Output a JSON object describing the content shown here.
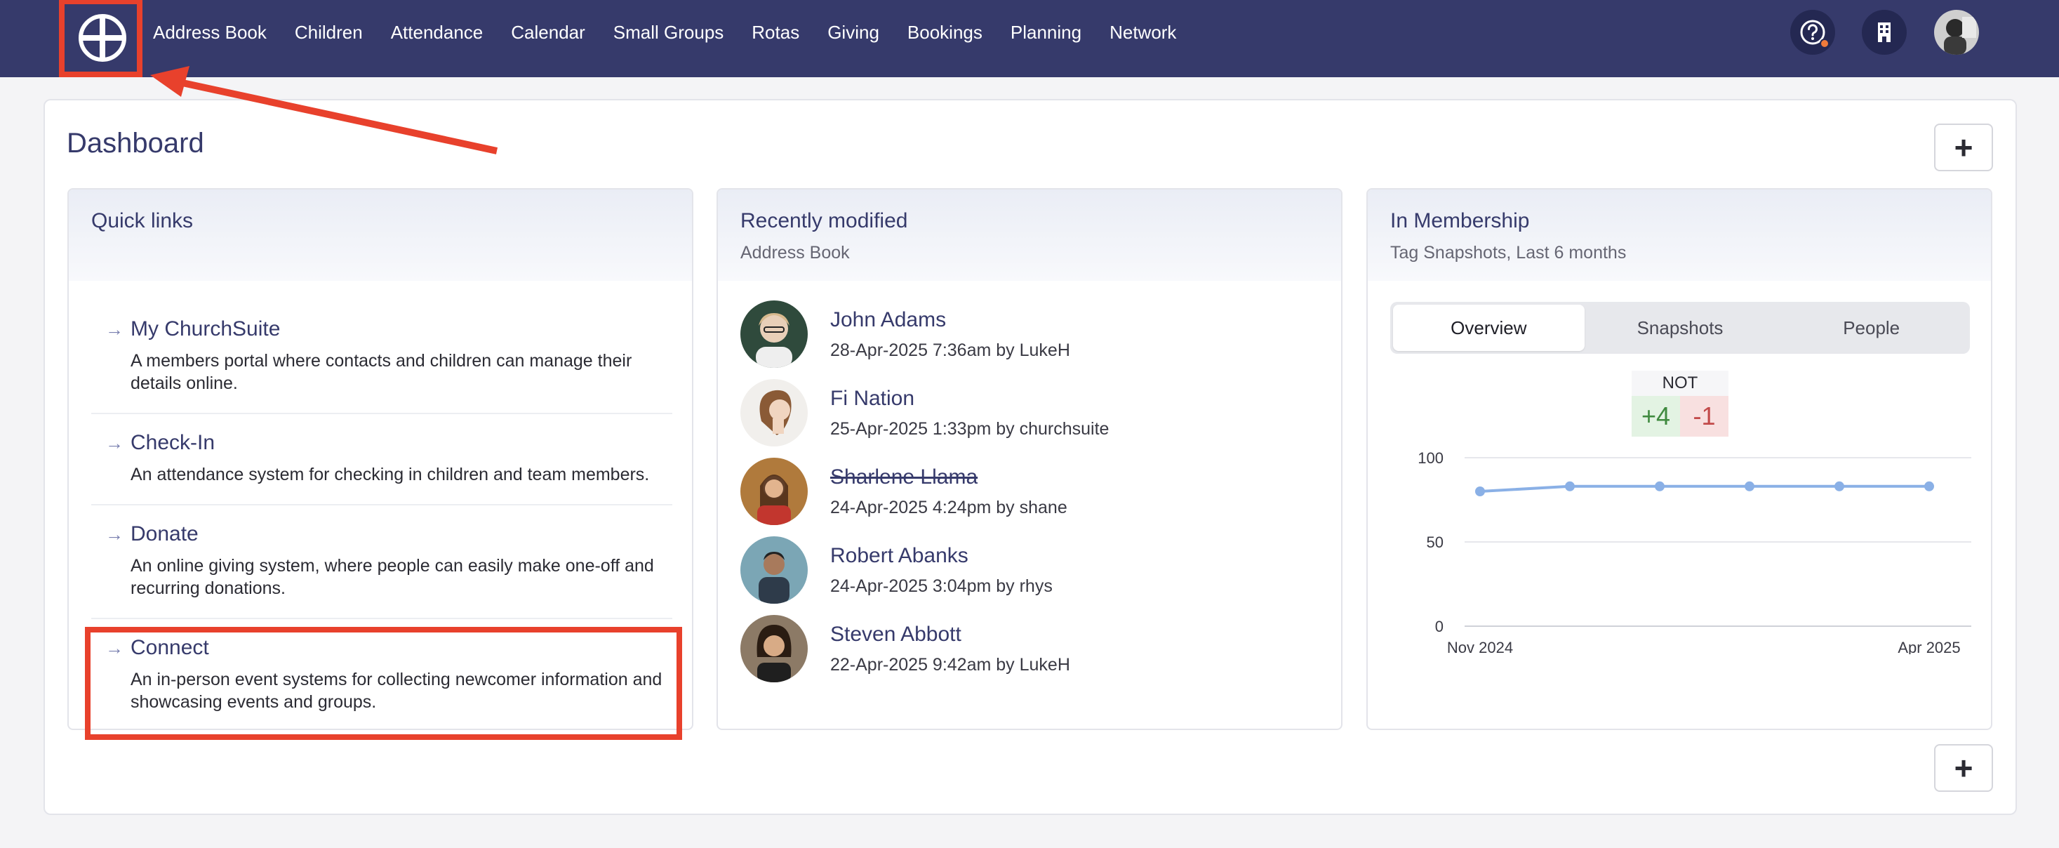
{
  "nav": {
    "links": [
      "Address Book",
      "Children",
      "Attendance",
      "Calendar",
      "Small Groups",
      "Rotas",
      "Giving",
      "Bookings",
      "Planning",
      "Network"
    ]
  },
  "page": {
    "title": "Dashboard"
  },
  "quick_links": {
    "title": "Quick links",
    "items": [
      {
        "title": "My ChurchSuite",
        "desc": "A members portal where contacts and children can manage their details online."
      },
      {
        "title": "Check-In",
        "desc": "An attendance system for checking in children and team members."
      },
      {
        "title": "Donate",
        "desc": "An online giving system, where people can easily make one-off and recurring donations."
      },
      {
        "title": "Connect",
        "desc": "An in-person event systems for collecting newcomer information and showcasing events and groups."
      }
    ]
  },
  "recent": {
    "title": "Recently modified",
    "subtitle": "Address Book",
    "items": [
      {
        "name": "John Adams",
        "meta": "28-Apr-2025 7:36am by LukeH"
      },
      {
        "name": "Fi Nation",
        "meta": "25-Apr-2025 1:33pm by churchsuite"
      },
      {
        "name": "Sharlene Llama",
        "meta": "24-Apr-2025 4:24pm by shane"
      },
      {
        "name": "Robert Abanks",
        "meta": "24-Apr-2025 3:04pm by rhys"
      },
      {
        "name": "Steven Abbott",
        "meta": "22-Apr-2025 9:42am by LukeH"
      }
    ]
  },
  "membership": {
    "title": "In Membership",
    "subtitle": "Tag Snapshots, Last 6 months",
    "tabs": [
      "Overview",
      "Snapshots",
      "People"
    ],
    "active_tab": "Overview",
    "not_label": "NOT",
    "not_pos": "+4",
    "not_neg": "-1"
  },
  "colors": {
    "nav": "#363a6b",
    "accent": "#363a6b",
    "line": "#8ab0e6",
    "annotation": "#e8412c"
  },
  "chart_data": {
    "type": "line",
    "x": [
      "Nov 2024",
      "Dec 2024",
      "Jan 2025",
      "Feb 2025",
      "Mar 2025",
      "Apr 2025"
    ],
    "x_tick_labels": [
      "Nov 2024",
      "Apr 2025"
    ],
    "y": [
      80,
      83,
      83,
      83,
      83,
      83
    ],
    "ylim": [
      0,
      100
    ],
    "yticks": [
      0,
      50,
      100
    ],
    "grid": true
  }
}
